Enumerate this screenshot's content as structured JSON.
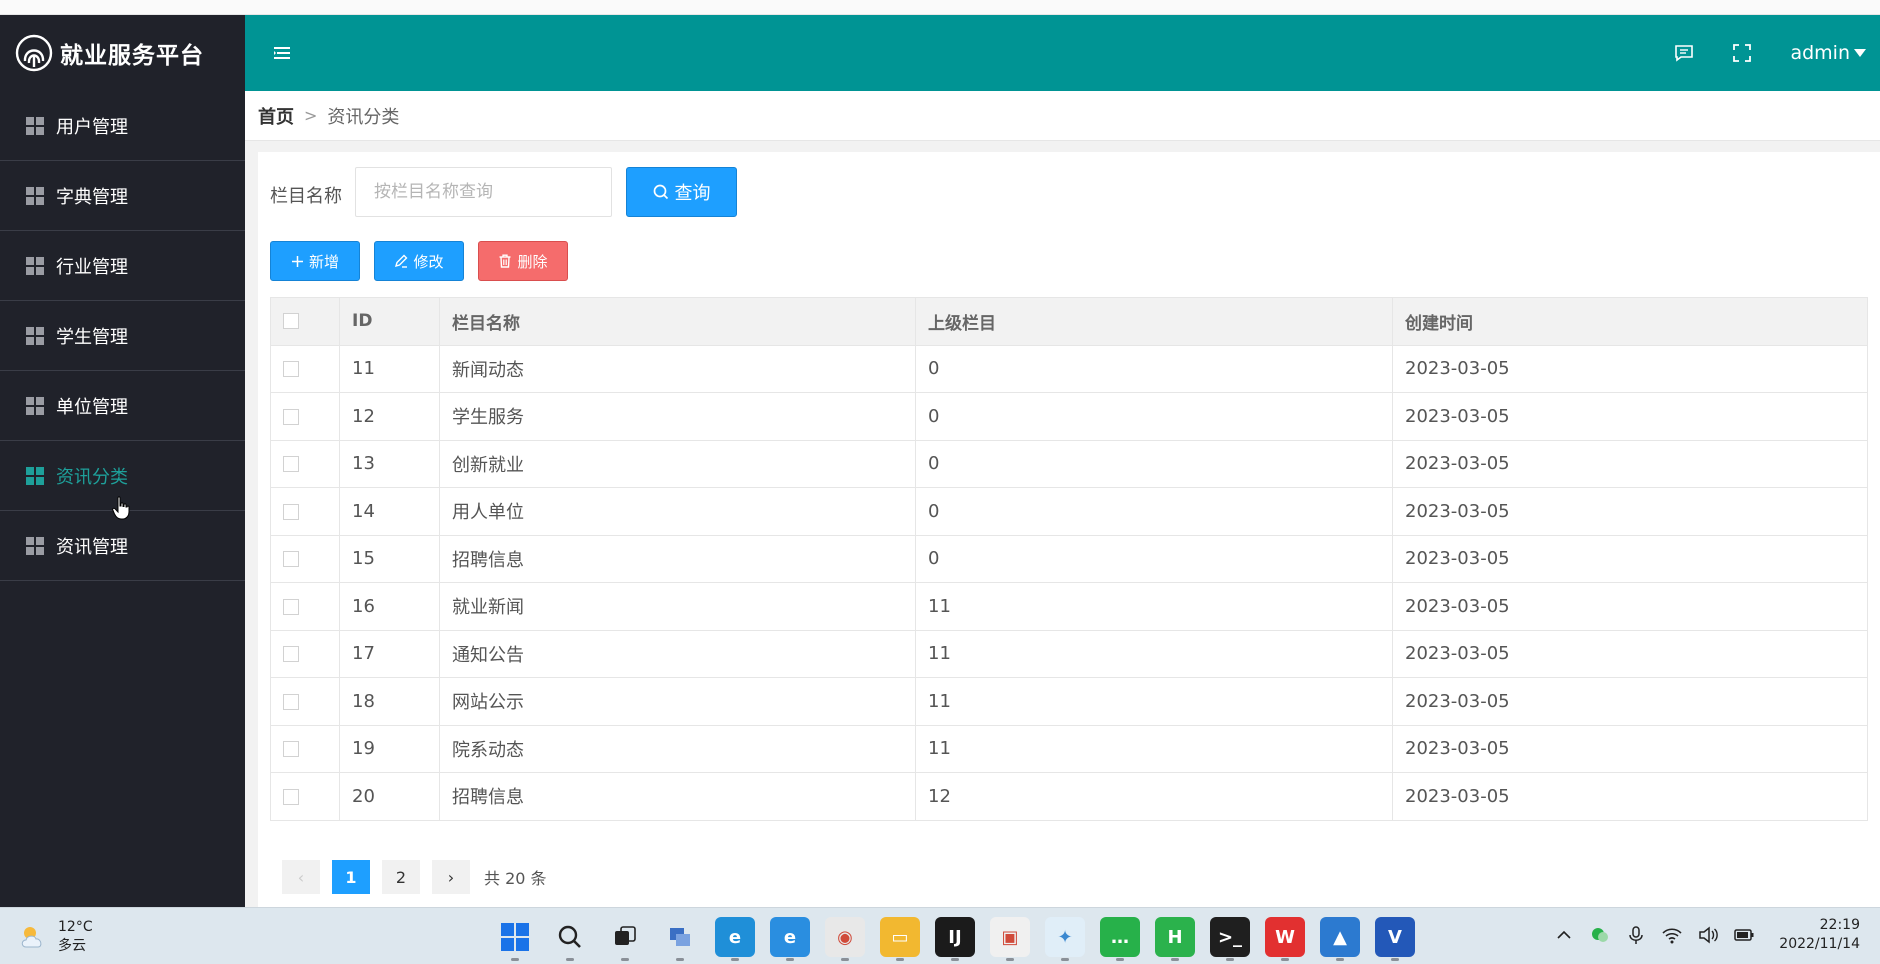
{
  "app": {
    "title": "就业服务平台",
    "user": "admin"
  },
  "sidebar": {
    "items": [
      {
        "label": "用户管理",
        "active": false
      },
      {
        "label": "字典管理",
        "active": false
      },
      {
        "label": "行业管理",
        "active": false
      },
      {
        "label": "学生管理",
        "active": false
      },
      {
        "label": "单位管理",
        "active": false
      },
      {
        "label": "资讯分类",
        "active": true
      },
      {
        "label": "资讯管理",
        "active": false
      }
    ]
  },
  "breadcrumb": {
    "home": "首页",
    "separator": ">",
    "current": "资讯分类"
  },
  "search": {
    "label": "栏目名称",
    "placeholder": "按栏目名称查询",
    "button": "查询"
  },
  "toolbar": {
    "add": "新增",
    "edit": "修改",
    "delete": "删除"
  },
  "table": {
    "headers": [
      "ID",
      "栏目名称",
      "上级栏目",
      "创建时间"
    ],
    "rows": [
      [
        "11",
        "新闻动态",
        "0",
        "2023-03-05"
      ],
      [
        "12",
        "学生服务",
        "0",
        "2023-03-05"
      ],
      [
        "13",
        "创新就业",
        "0",
        "2023-03-05"
      ],
      [
        "14",
        "用人单位",
        "0",
        "2023-03-05"
      ],
      [
        "15",
        "招聘信息",
        "0",
        "2023-03-05"
      ],
      [
        "16",
        "就业新闻",
        "11",
        "2023-03-05"
      ],
      [
        "17",
        "通知公告",
        "11",
        "2023-03-05"
      ],
      [
        "18",
        "网站公示",
        "11",
        "2023-03-05"
      ],
      [
        "19",
        "院系动态",
        "11",
        "2023-03-05"
      ],
      [
        "20",
        "招聘信息",
        "12",
        "2023-03-05"
      ]
    ]
  },
  "pagination": {
    "prev": "‹",
    "pages": [
      "1",
      "2"
    ],
    "current": "1",
    "next": "›",
    "total": "共 20 条"
  },
  "taskbar": {
    "weather_temp": "12°C",
    "weather_desc": "多云",
    "time": "22:19",
    "date": "2022/11/14",
    "apps": [
      {
        "name": "start",
        "color": "#1a73e8",
        "glyph": "⊞"
      },
      {
        "name": "search",
        "color": "#dde7ee",
        "glyph": ""
      },
      {
        "name": "task-view",
        "color": "#dde7ee",
        "glyph": ""
      },
      {
        "name": "app-1",
        "color": "#dde7ee",
        "glyph": ""
      },
      {
        "name": "edge",
        "color": "#1f8fd8",
        "glyph": "e"
      },
      {
        "name": "ie",
        "color": "#2a8ee0",
        "glyph": "e"
      },
      {
        "name": "chrome",
        "color": "#e8e8e8",
        "glyph": "◉"
      },
      {
        "name": "explorer",
        "color": "#f2b830",
        "glyph": "▭"
      },
      {
        "name": "intellij",
        "color": "#1b1b1b",
        "glyph": "IJ"
      },
      {
        "name": "slides",
        "color": "#f0f0f0",
        "glyph": "▣"
      },
      {
        "name": "feather",
        "color": "#e0eef8",
        "glyph": "✦"
      },
      {
        "name": "wechat",
        "color": "#27b14a",
        "glyph": "…"
      },
      {
        "name": "hbuilder",
        "color": "#2bb24c",
        "glyph": "H"
      },
      {
        "name": "terminal",
        "color": "#1f1f1f",
        "glyph": ">_"
      },
      {
        "name": "wps",
        "color": "#e23030",
        "glyph": "W"
      },
      {
        "name": "photos",
        "color": "#2c7ad0",
        "glyph": "▲"
      },
      {
        "name": "visio",
        "color": "#2358b8",
        "glyph": "V"
      }
    ]
  }
}
